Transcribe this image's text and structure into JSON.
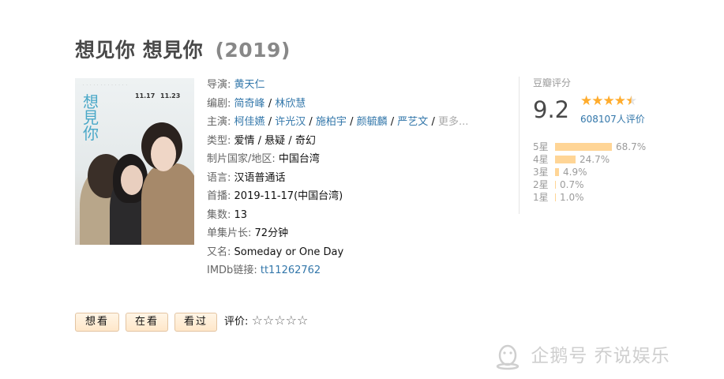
{
  "title": {
    "name": "想见你 想見你",
    "year": "(2019)"
  },
  "poster": {
    "title_art": "想見你",
    "date1": "11.17",
    "date2": "11.23"
  },
  "info": {
    "director_label": "导演:",
    "director": "黄天仁",
    "writer_label": "编剧:",
    "writer1": "简奇峰",
    "writer2": "林欣慧",
    "cast_label": "主演:",
    "cast": [
      "柯佳嬿",
      "许光汉",
      "施柏宇",
      "颜毓麟",
      "严艺文"
    ],
    "cast_more": "更多...",
    "genre_label": "类型:",
    "genre": "爱情 / 悬疑 / 奇幻",
    "country_label": "制片国家/地区:",
    "country": "中国台湾",
    "language_label": "语言:",
    "language": "汉语普通话",
    "premiere_label": "首播:",
    "premiere": "2019-11-17(中国台湾)",
    "episodes_label": "集数:",
    "episodes": "13",
    "length_label": "单集片长:",
    "length": "72分钟",
    "aka_label": "又名:",
    "aka": "Someday or One Day",
    "imdb_label": "IMDb链接:",
    "imdb": "tt11262762"
  },
  "rating": {
    "label": "豆瓣评分",
    "score": "9.2",
    "stars_value": 4.5,
    "votes": "608107人评价",
    "distribution": [
      {
        "label": "5星",
        "pct": "68.7%",
        "value": 68.7
      },
      {
        "label": "4星",
        "pct": "24.7%",
        "value": 24.7
      },
      {
        "label": "3星",
        "pct": "4.9%",
        "value": 4.9
      },
      {
        "label": "2星",
        "pct": "0.7%",
        "value": 0.7
      },
      {
        "label": "1星",
        "pct": "1.0%",
        "value": 1.0
      }
    ]
  },
  "actions": {
    "want": "想看",
    "doing": "在看",
    "done": "看过",
    "rate_label": "评价:",
    "rate_stars": "☆☆☆☆☆"
  },
  "watermark": {
    "text": "企鹅号 乔说娱乐"
  },
  "colors": {
    "link": "#3377aa",
    "star": "#ffac2d",
    "bar": "#ffd596"
  }
}
